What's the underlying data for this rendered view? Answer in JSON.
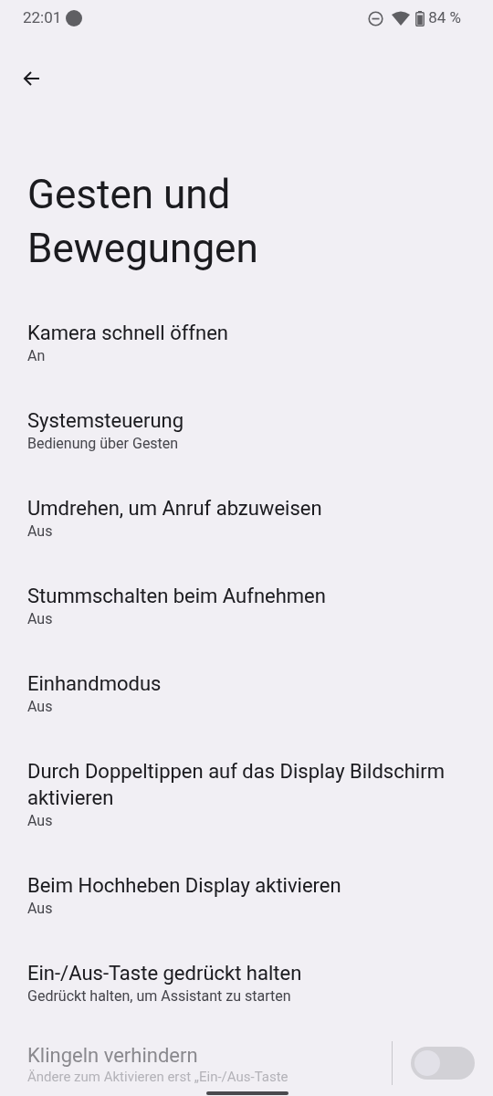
{
  "status_bar": {
    "time": "22:01",
    "battery": "84 %"
  },
  "title": "Gesten und Bewegungen",
  "items": [
    {
      "title": "Kamera schnell öffnen",
      "summary": "An",
      "disabled": false,
      "kind": "link"
    },
    {
      "title": "Systemsteuerung",
      "summary": "Bedienung über Gesten",
      "disabled": false,
      "kind": "link"
    },
    {
      "title": "Umdrehen, um Anruf abzuweisen",
      "summary": "Aus",
      "disabled": false,
      "kind": "link"
    },
    {
      "title": "Stummschalten beim Aufnehmen",
      "summary": "Aus",
      "disabled": false,
      "kind": "link"
    },
    {
      "title": "Einhandmodus",
      "summary": "Aus",
      "disabled": false,
      "kind": "link"
    },
    {
      "title": "Durch Doppeltippen auf das Display Bildschirm aktivieren",
      "summary": "Aus",
      "disabled": false,
      "kind": "link"
    },
    {
      "title": "Beim Hochheben Display aktivieren",
      "summary": "Aus",
      "disabled": false,
      "kind": "link"
    },
    {
      "title": "Ein-/Aus-Taste gedrückt halten",
      "summary": "Gedrückt halten, um Assistant zu starten",
      "disabled": false,
      "kind": "link"
    },
    {
      "title": "Klingeln verhindern",
      "summary": "Ändere zum Aktivieren erst „Ein-/Aus-Taste",
      "disabled": true,
      "kind": "switch",
      "on": false
    }
  ]
}
